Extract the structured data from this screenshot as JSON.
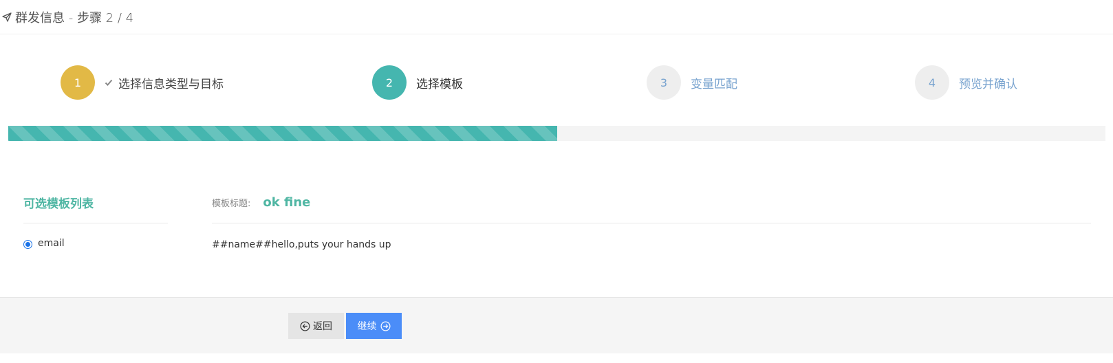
{
  "header": {
    "title": "群发信息 - 步骤 2 / 4",
    "icon": "send-icon"
  },
  "steps": [
    {
      "number": "1",
      "label": "选择信息类型与目标",
      "state": "done",
      "icon": "check-icon"
    },
    {
      "number": "2",
      "label": "选择模板",
      "state": "active"
    },
    {
      "number": "3",
      "label": "变量匹配",
      "state": "todo"
    },
    {
      "number": "4",
      "label": "预览并确认",
      "state": "todo"
    }
  ],
  "progress": {
    "percent": 50,
    "color": "#45b6af"
  },
  "template_list": {
    "title": "可选模板列表",
    "options": [
      {
        "label": "email",
        "selected": true
      }
    ]
  },
  "template_detail": {
    "title_label": "模板标题:",
    "title_value": "ok fine",
    "content": "##name##hello,puts your hands up"
  },
  "footer": {
    "back_label": "返回",
    "back_icon": "arrow-left-circle-icon",
    "next_label": "继续",
    "next_icon": "arrow-right-circle-icon"
  },
  "colors": {
    "done": "#e2b946",
    "active": "#45b6af",
    "todo_text": "#78a3cf",
    "accent_text": "#4fb6a3",
    "primary_button": "#4b8df8"
  }
}
